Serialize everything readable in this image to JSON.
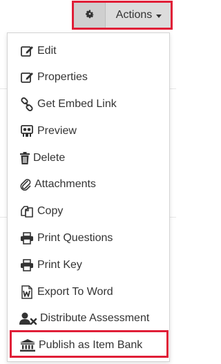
{
  "toolbar": {
    "settings_icon": "gear-icon",
    "actions_label": "Actions"
  },
  "menu": {
    "items": [
      {
        "label": "Edit",
        "icon": "edit-icon"
      },
      {
        "label": "Properties",
        "icon": "properties-icon"
      },
      {
        "label": "Get Embed Link",
        "icon": "link-icon"
      },
      {
        "label": "Preview",
        "icon": "preview-icon"
      },
      {
        "label": "Delete",
        "icon": "trash-icon"
      },
      {
        "label": "Attachments",
        "icon": "paperclip-icon"
      },
      {
        "label": "Copy",
        "icon": "copy-icon"
      },
      {
        "label": "Print Questions",
        "icon": "printer-icon"
      },
      {
        "label": "Print Key",
        "icon": "printer-icon"
      },
      {
        "label": "Export To Word",
        "icon": "word-icon"
      },
      {
        "label": "Distribute Assessment",
        "icon": "user-remove-icon"
      },
      {
        "label": "Publish as Item Bank",
        "icon": "bank-icon"
      }
    ]
  },
  "colors": {
    "highlight": "#e01e37",
    "text": "#333333",
    "button_bg": "#dcdcdc"
  }
}
